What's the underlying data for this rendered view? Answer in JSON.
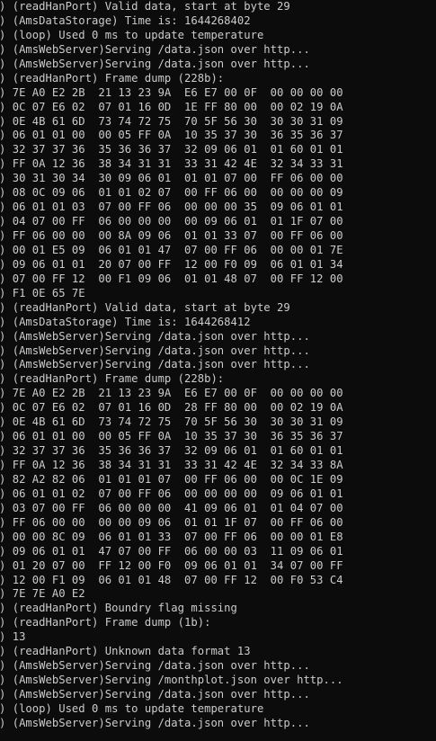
{
  "console": {
    "lines": [
      ") (readHanPort) Valid data, start at byte 29",
      ") (AmsDataStorage) Time is: 1644268402",
      ") (loop) Used 0 ms to update temperature",
      ") (AmsWebServer)Serving /data.json over http...",
      ") (AmsWebServer)Serving /data.json over http...",
      ") (readHanPort) Frame dump (228b):",
      ") 7E A0 E2 2B  21 13 23 9A  E6 E7 00 0F  00 00 00 00",
      ") 0C 07 E6 02  07 01 16 0D  1E FF 80 00  00 02 19 0A",
      ") 0E 4B 61 6D  73 74 72 75  70 5F 56 30  30 30 31 09",
      ") 06 01 01 00  00 05 FF 0A  10 35 37 30  36 35 36 37",
      ") 32 37 37 36  35 36 36 37  32 09 06 01  01 60 01 01",
      ") FF 0A 12 36  38 34 31 31  33 31 42 4E  32 34 33 31",
      ") 30 31 30 34  30 09 06 01  01 01 07 00  FF 06 00 00",
      ") 08 0C 09 06  01 01 02 07  00 FF 06 00  00 00 00 09",
      ") 06 01 01 03  07 00 FF 06  00 00 00 35  09 06 01 01",
      ") 04 07 00 FF  06 00 00 00  00 09 06 01  01 1F 07 00",
      ") FF 06 00 00  00 8A 09 06  01 01 33 07  00 FF 06 00",
      ") 00 01 E5 09  06 01 01 47  07 00 FF 06  00 00 01 7E",
      ") 09 06 01 01  20 07 00 FF  12 00 F0 09  06 01 01 34",
      ") 07 00 FF 12  00 F1 09 06  01 01 48 07  00 FF 12 00",
      ") F1 0E 65 7E",
      ") (readHanPort) Valid data, start at byte 29",
      ") (AmsDataStorage) Time is: 1644268412",
      ") (AmsWebServer)Serving /data.json over http...",
      ") (AmsWebServer)Serving /data.json over http...",
      ") (AmsWebServer)Serving /data.json over http...",
      ") (readHanPort) Frame dump (228b):",
      ") 7E A0 E2 2B  21 13 23 9A  E6 E7 00 0F  00 00 00 00",
      ") 0C 07 E6 02  07 01 16 0D  28 FF 80 00  00 02 19 0A",
      ") 0E 4B 61 6D  73 74 72 75  70 5F 56 30  30 30 31 09",
      ") 06 01 01 00  00 05 FF 0A  10 35 37 30  36 35 36 37",
      ") 32 37 37 36  35 36 36 37  32 09 06 01  01 60 01 01",
      ") FF 0A 12 36  38 34 31 31  33 31 42 4E  32 34 33 8A",
      ") 82 A2 82 06  01 01 01 07  00 FF 06 00  00 0C 1E 09",
      ") 06 01 01 02  07 00 FF 06  00 00 00 00  09 06 01 01",
      ") 03 07 00 FF  06 00 00 00  41 09 06 01  01 04 07 00",
      ") FF 06 00 00  00 00 09 06  01 01 1F 07  00 FF 06 00",
      ") 00 00 8C 09  06 01 01 33  07 00 FF 06  00 00 01 E8",
      ") 09 06 01 01  47 07 00 FF  06 00 00 03  11 09 06 01",
      ") 01 20 07 00  FF 12 00 F0  09 06 01 01  34 07 00 FF",
      ") 12 00 F1 09  06 01 01 48  07 00 FF 12  00 F0 53 C4",
      ") 7E 7E A0 E2",
      ") (readHanPort) Boundry flag missing",
      ") (readHanPort) Frame dump (1b):",
      ") 13",
      ") (readHanPort) Unknown data format 13",
      ") (AmsWebServer)Serving /data.json over http...",
      ") (AmsWebServer)Serving /monthplot.json over http...",
      ") (AmsWebServer)Serving /data.json over http...",
      ") (loop) Used 0 ms to update temperature",
      ") (AmsWebServer)Serving /data.json over http..."
    ]
  }
}
